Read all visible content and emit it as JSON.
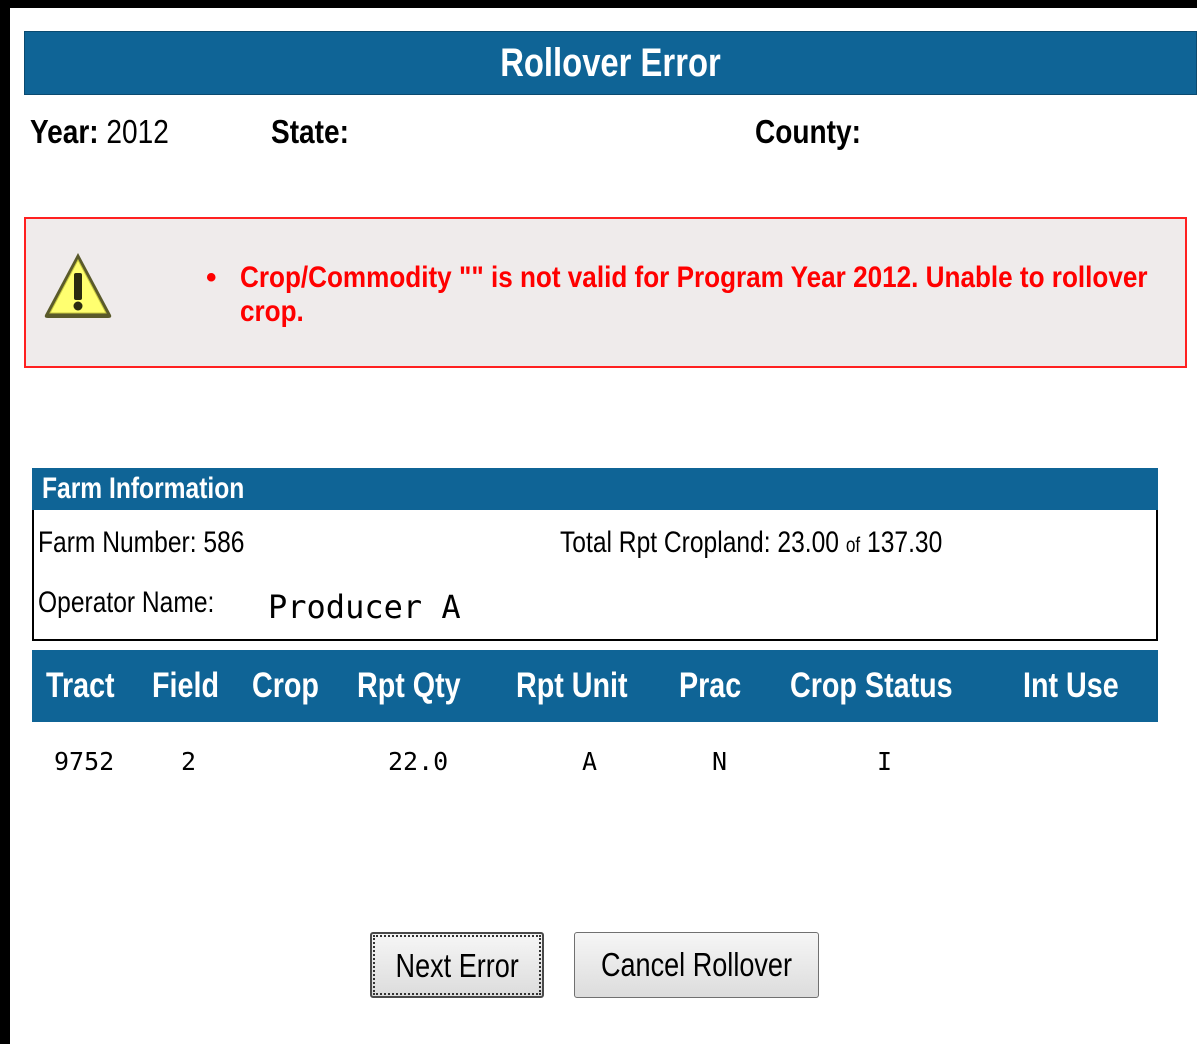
{
  "title": "Rollover Error",
  "header": {
    "year_label": "Year:",
    "year_value": "2012",
    "state_label": "State:",
    "state_value": "",
    "county_label": "County:",
    "county_value": ""
  },
  "alert": {
    "icon": "warning-triangle-icon",
    "border_color": "#ff2020",
    "text_color": "#ff0000",
    "bullet": "•",
    "message": "Crop/Commodity \"\" is not valid for Program Year 2012. Unable to rollover crop."
  },
  "farm": {
    "heading": "Farm Information",
    "farm_number_label": "Farm Number:",
    "farm_number_value": "586",
    "total_label": "Total Rpt Cropland:",
    "total_reported": "23.00",
    "of_label": "of",
    "total_cropland": "137.30",
    "operator_label": "Operator Name:",
    "operator_value": "Producer A"
  },
  "table": {
    "header_color": "#0f6496",
    "columns": [
      "Tract",
      "Field",
      "Crop",
      "Rpt Qty",
      "Rpt Unit",
      "Prac",
      "Crop Status",
      "Int Use"
    ],
    "rows": [
      [
        "9752",
        "2",
        "",
        "22.0",
        "A",
        "N",
        "I",
        ""
      ]
    ]
  },
  "buttons": {
    "next_error": "Next Error",
    "cancel_rollover": "Cancel Rollover"
  }
}
